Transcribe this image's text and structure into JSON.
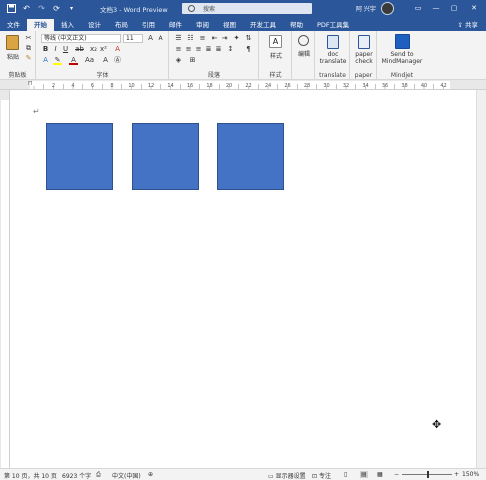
{
  "titlebar": {
    "doc_title": "文档3 - Word Preview",
    "search_placeholder": "搜索",
    "user_name": "阿 兴宇",
    "autosave_icon": "save-icon",
    "colors": {
      "bg": "#2b579a"
    }
  },
  "tabs": [
    "文件",
    "开始",
    "插入",
    "设计",
    "布局",
    "引用",
    "邮件",
    "审阅",
    "视图",
    "开发工具",
    "帮助",
    "PDF工具集"
  ],
  "active_tab": "开始",
  "share_label": "共享",
  "ribbon": {
    "clipboard": {
      "paste_label": "粘贴",
      "group_label": "剪贴板"
    },
    "font": {
      "font_name": "等线 (中文正文)",
      "font_size": "11",
      "group_label": "字体"
    },
    "paragraph": {
      "group_label": "段落"
    },
    "styles": {
      "styles_label": "样式",
      "group_label": "样式"
    },
    "editing": {
      "edit_label": "编辑"
    },
    "translate": {
      "button_label": "doc translate",
      "group_label": "translate"
    },
    "paper": {
      "button_label": "paper check",
      "group_label": "paper"
    },
    "mindjet": {
      "button_label": "Send to MindManager",
      "group_label": "Mindjet"
    }
  },
  "ruler_numbers": [
    "2",
    "4",
    "6",
    "8",
    "10",
    "12",
    "14",
    "16",
    "18",
    "20",
    "22",
    "24",
    "26",
    "28",
    "30",
    "32",
    "34",
    "36",
    "38",
    "40",
    "42"
  ],
  "document": {
    "paragraph_mark": "↵",
    "shapes": [
      {
        "color": "#4472c4"
      },
      {
        "color": "#4472c4"
      },
      {
        "color": "#4472c4"
      }
    ]
  },
  "status": {
    "page": "第 10 页，共 10 页",
    "words": "6923 个字",
    "language": "中文(中国)",
    "display_settings": "显示器设置",
    "focus": "专注",
    "zoom": "150%"
  }
}
